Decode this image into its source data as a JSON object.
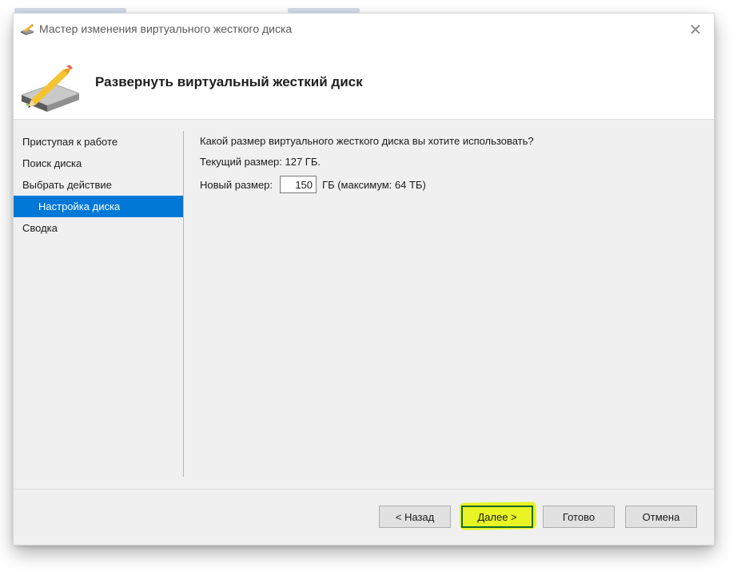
{
  "window": {
    "title": "Мастер изменения виртуального жесткого диска",
    "close_icon": "close-icon",
    "app_icon": "disk-wizard-icon"
  },
  "header": {
    "title": "Развернуть виртуальный жесткий диск",
    "icon": "disk-pencil-icon"
  },
  "sidebar": {
    "items": [
      {
        "label": "Приступая к работе",
        "selected": false
      },
      {
        "label": "Поиск диска",
        "selected": false
      },
      {
        "label": "Выбрать действие",
        "selected": false
      },
      {
        "label": "Настройка диска",
        "selected": true
      },
      {
        "label": "Сводка",
        "selected": false
      }
    ]
  },
  "content": {
    "question": "Какой размер виртуального жесткого диска вы хотите использовать?",
    "current_size": "Текущий размер: 127 ГБ.",
    "new_size_label": "Новый размер:",
    "new_size_value": "150",
    "new_size_suffix": "ГБ (максимум: 64 ТБ)"
  },
  "buttons": {
    "back": "< Назад",
    "next": "Далее >",
    "finish": "Готово",
    "cancel": "Отмена"
  },
  "colors": {
    "accent": "#0078d7",
    "highlight": "#e6f500",
    "window_bg": "#f0f0f0"
  }
}
